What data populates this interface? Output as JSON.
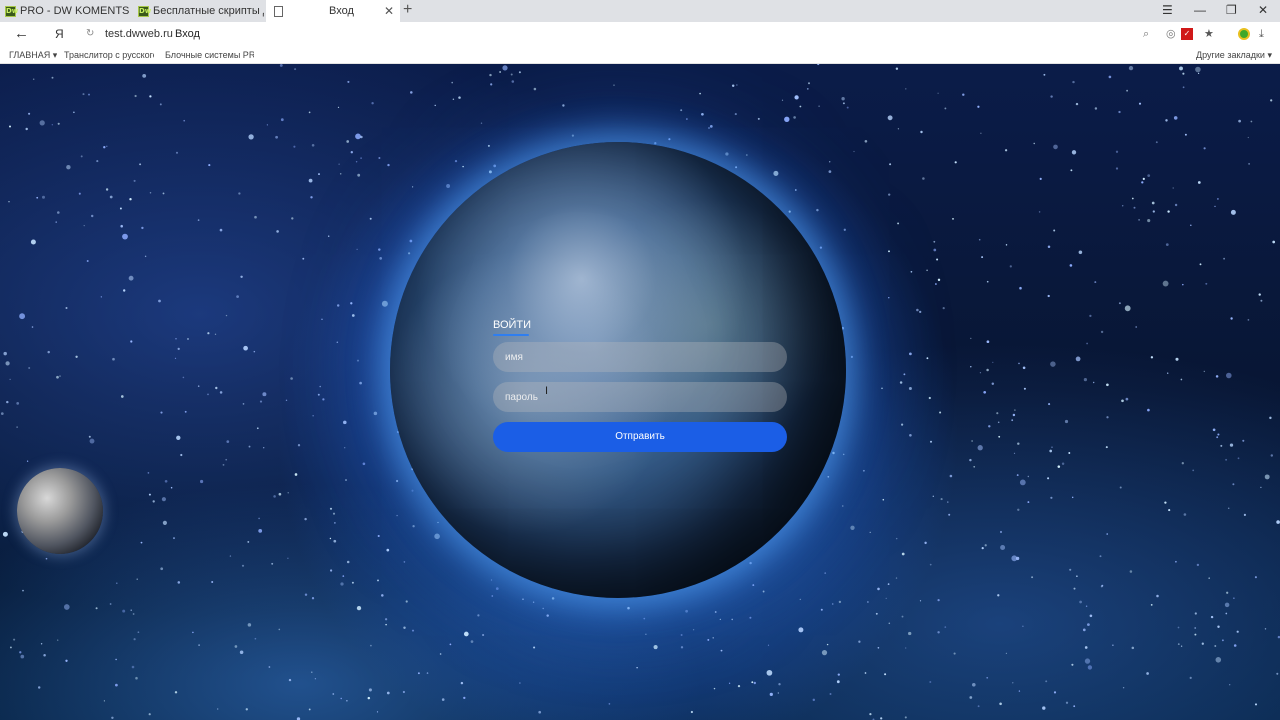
{
  "browser": {
    "tabs": [
      {
        "label": "PRO - DW KOMENTS – про",
        "favicon": "dw-icon"
      },
      {
        "label": "Бесплатные скрипты для са",
        "favicon": "dw-icon"
      },
      {
        "label": "Вход",
        "favicon": "page-icon",
        "active": true
      }
    ],
    "new_tab": "+",
    "window_controls": {
      "menu": "☰",
      "minimize": "—",
      "restore": "❐",
      "close": "✕"
    },
    "address": {
      "ya": "Я",
      "url": "test.dwweb.ru",
      "title": "Вход"
    },
    "bookmarks": [
      {
        "label": "ГЛАВНАЯ ▾"
      },
      {
        "label": "Транслитор с русского"
      },
      {
        "label": "Блочные системы PRO"
      }
    ],
    "other_bookmarks": "Другие закладки ▾"
  },
  "login": {
    "title": "ВОЙТИ",
    "name_placeholder": "имя",
    "password_placeholder": "пароль",
    "submit_label": "Отправить",
    "accent_color": "#1b5ee6"
  }
}
